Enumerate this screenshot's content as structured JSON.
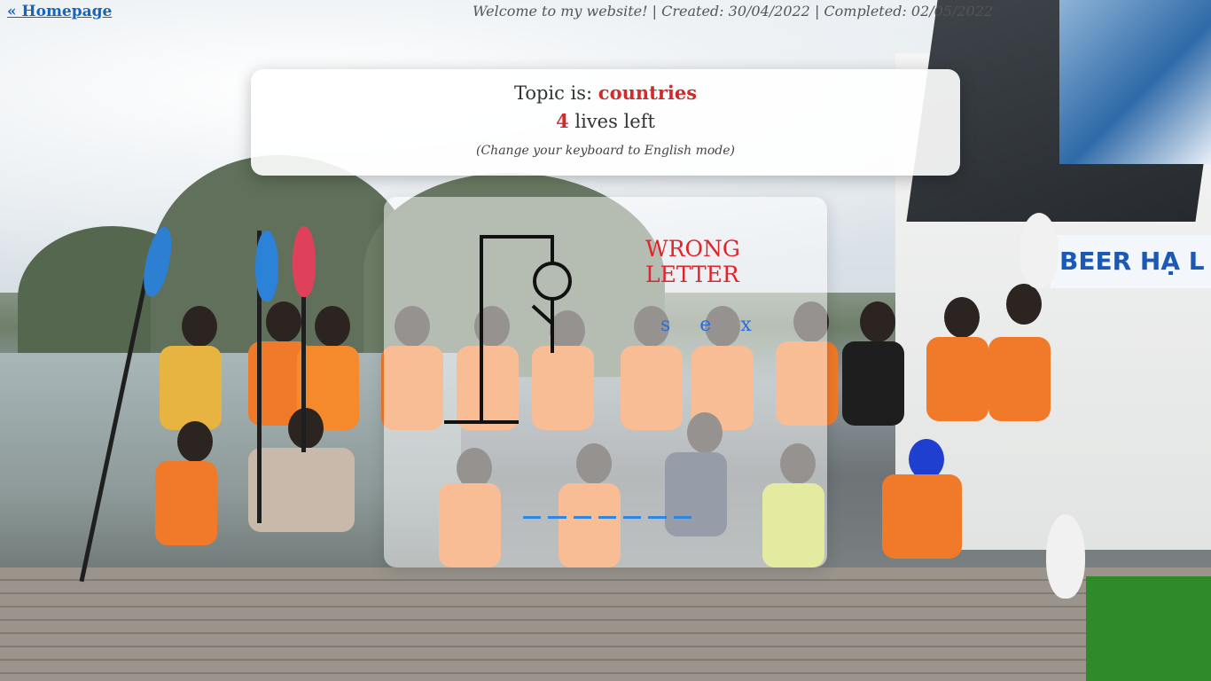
{
  "header": {
    "home_link": "« Homepage",
    "welcome_text": "Welcome to my website! | Created: 30/04/2022 | Completed: 02/05/2022"
  },
  "topic_card": {
    "topic_prefix": "Topic is: ",
    "topic_value": "countries",
    "lives_count": "4",
    "lives_suffix": " lives left",
    "hint": "(Change your keyboard to English mode)"
  },
  "game": {
    "wrong_title_line1": "WRONG",
    "wrong_title_line2": "LETTER",
    "wrong_letters": "s e x",
    "blank_count": 7
  },
  "background": {
    "sign_text": "BEER HẠ L"
  },
  "colors": {
    "accent_red": "#d02b2b",
    "wrong_red": "#e0242c",
    "link_blue": "#1565c0",
    "letter_blue": "#2f6cd6",
    "blank_blue": "#2f86e0"
  }
}
